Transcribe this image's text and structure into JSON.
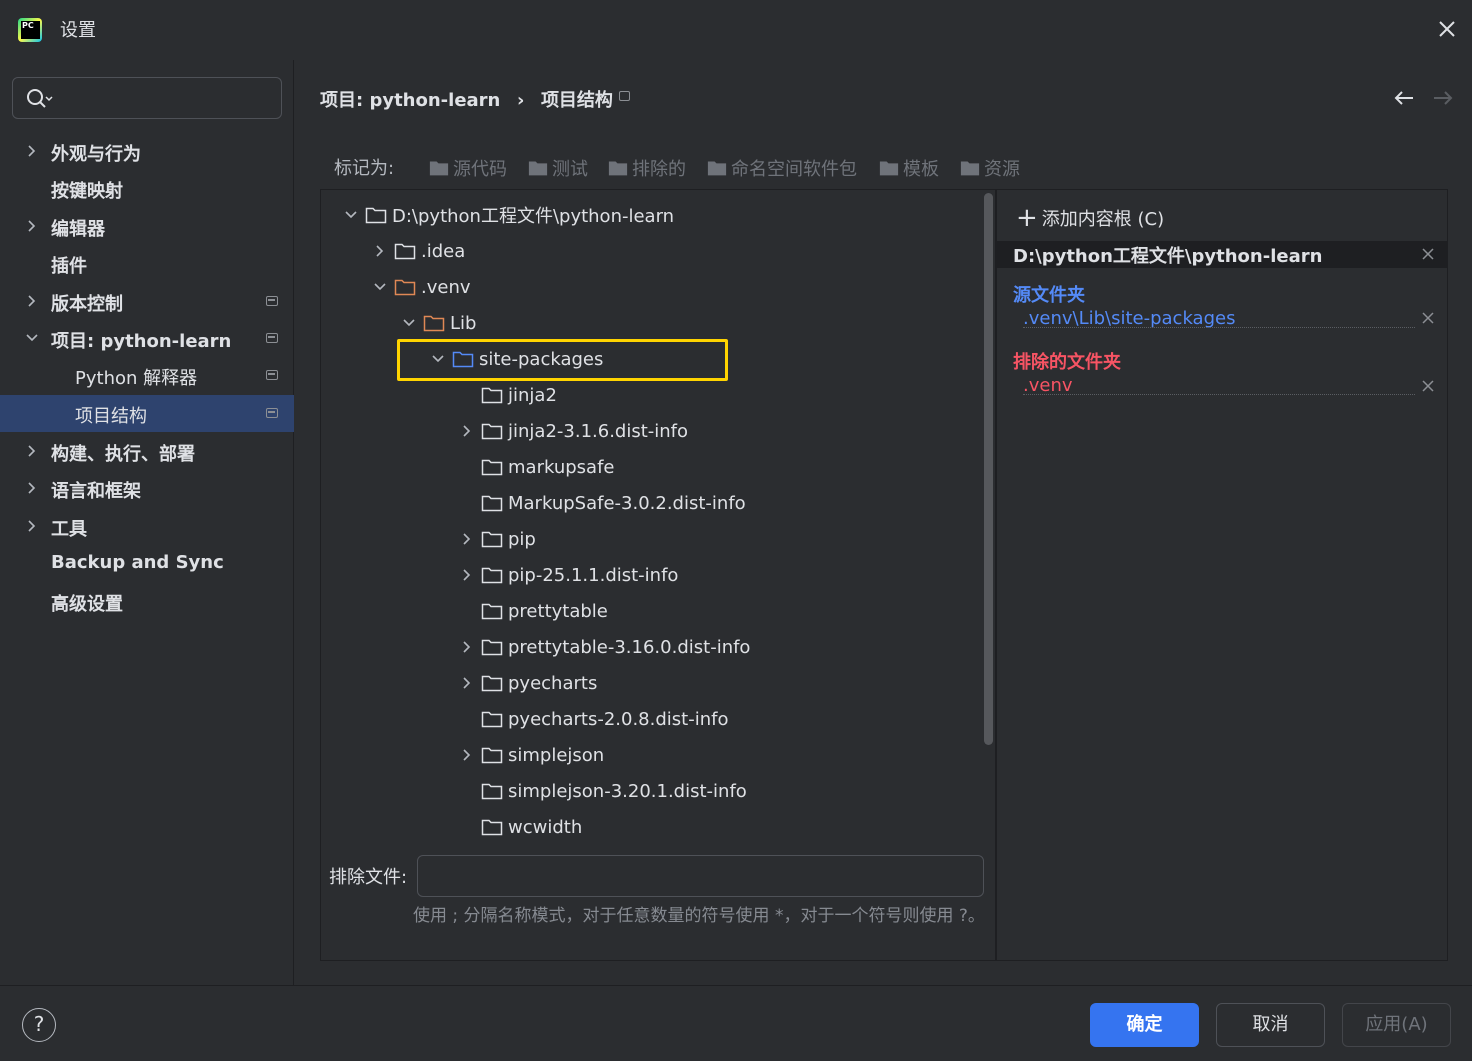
{
  "window": {
    "title": "设置"
  },
  "sidebar": {
    "items": [
      {
        "label": "外观与行为",
        "expandable": true,
        "expanded": false
      },
      {
        "label": "按键映射",
        "expandable": false
      },
      {
        "label": "编辑器",
        "expandable": true,
        "expanded": false
      },
      {
        "label": "插件",
        "expandable": false
      },
      {
        "label": "版本控制",
        "expandable": true,
        "expanded": false,
        "pinned": true
      },
      {
        "label": "项目: python-learn",
        "expandable": true,
        "expanded": true,
        "pinned": true
      },
      {
        "label": "Python 解释器",
        "sub": true,
        "pinned": true
      },
      {
        "label": "项目结构",
        "sub": true,
        "pinned": true,
        "selected": true
      },
      {
        "label": "构建、执行、部署",
        "expandable": true,
        "expanded": false
      },
      {
        "label": "语言和框架",
        "expandable": true,
        "expanded": false
      },
      {
        "label": "工具",
        "expandable": true,
        "expanded": false
      },
      {
        "label": "Backup and Sync",
        "expandable": false
      },
      {
        "label": "高级设置",
        "expandable": false
      }
    ]
  },
  "breadcrumb": {
    "project": "项目: python-learn",
    "page": "项目结构",
    "separator": "›"
  },
  "mark_as": {
    "label": "标记为:",
    "options": [
      "源代码",
      "测试",
      "排除的",
      "命名空间软件包",
      "模板",
      "资源"
    ]
  },
  "tree": [
    {
      "label": "D:\\python工程文件\\python-learn",
      "depth": 0,
      "chevron": "down",
      "color": "default"
    },
    {
      "label": ".idea",
      "depth": 1,
      "chevron": "right",
      "color": "default"
    },
    {
      "label": ".venv",
      "depth": 1,
      "chevron": "down",
      "color": "orange"
    },
    {
      "label": "Lib",
      "depth": 2,
      "chevron": "down",
      "color": "orange"
    },
    {
      "label": "site-packages",
      "depth": 3,
      "chevron": "down",
      "color": "blue",
      "highlighted": true
    },
    {
      "label": "jinja2",
      "depth": 4,
      "chevron": "none",
      "color": "default"
    },
    {
      "label": "jinja2-3.1.6.dist-info",
      "depth": 4,
      "chevron": "right",
      "color": "default"
    },
    {
      "label": "markupsafe",
      "depth": 4,
      "chevron": "none",
      "color": "default"
    },
    {
      "label": "MarkupSafe-3.0.2.dist-info",
      "depth": 4,
      "chevron": "none",
      "color": "default"
    },
    {
      "label": "pip",
      "depth": 4,
      "chevron": "right",
      "color": "default"
    },
    {
      "label": "pip-25.1.1.dist-info",
      "depth": 4,
      "chevron": "right",
      "color": "default"
    },
    {
      "label": "prettytable",
      "depth": 4,
      "chevron": "none",
      "color": "default"
    },
    {
      "label": "prettytable-3.16.0.dist-info",
      "depth": 4,
      "chevron": "right",
      "color": "default"
    },
    {
      "label": "pyecharts",
      "depth": 4,
      "chevron": "right",
      "color": "default"
    },
    {
      "label": "pyecharts-2.0.8.dist-info",
      "depth": 4,
      "chevron": "none",
      "color": "default"
    },
    {
      "label": "simplejson",
      "depth": 4,
      "chevron": "right",
      "color": "default"
    },
    {
      "label": "simplejson-3.20.1.dist-info",
      "depth": 4,
      "chevron": "none",
      "color": "default"
    },
    {
      "label": "wcwidth",
      "depth": 4,
      "chevron": "none",
      "color": "default"
    }
  ],
  "exclude": {
    "label": "排除文件:",
    "value": "",
    "hint": "使用 ; 分隔名称模式，对于任意数量的符号使用 *，对于一个符号则使用 ?。"
  },
  "content_roots": {
    "add_label": "添加内容根 (C)",
    "root_path": "D:\\python工程文件\\python-learn",
    "source_title": "源文件夹",
    "source_entry": ".venv\\Lib\\site-packages",
    "excluded_title": "排除的文件夹",
    "excluded_entry": ".venv"
  },
  "footer": {
    "help": "?",
    "ok": "确定",
    "cancel": "取消",
    "apply": "应用(A)"
  },
  "colors": {
    "accent": "#3574f0",
    "source_blue": "#548af7",
    "excluded_red": "#f75464",
    "folder_orange": "#e08855",
    "highlight_yellow": "#ffd400"
  }
}
